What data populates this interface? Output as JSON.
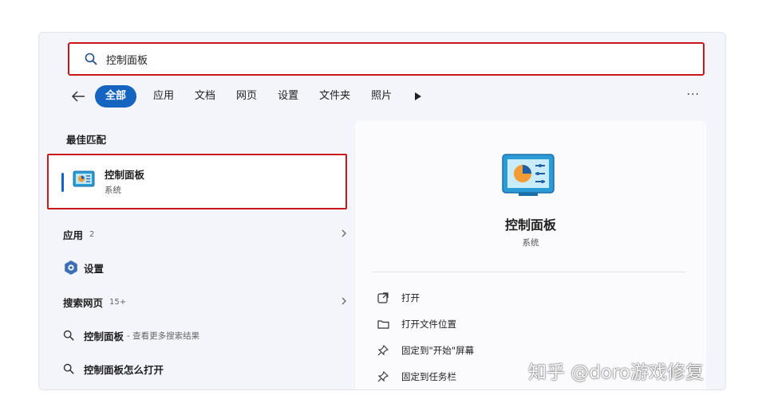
{
  "search": {
    "query": "控制面板",
    "icon": "search-icon"
  },
  "filters": {
    "tabs": [
      {
        "label": "全部",
        "active": true
      },
      {
        "label": "应用"
      },
      {
        "label": "文档"
      },
      {
        "label": "网页"
      },
      {
        "label": "设置"
      },
      {
        "label": "文件夹"
      },
      {
        "label": "照片"
      }
    ],
    "more_label": "···"
  },
  "left": {
    "best_match_title": "最佳匹配",
    "best_match": {
      "title": "控制面板",
      "subtitle": "系统"
    },
    "apps_section": {
      "label": "应用",
      "count": "2"
    },
    "settings_item": {
      "label": "设置"
    },
    "web_section": {
      "label": "搜索网页",
      "count": "15+"
    },
    "web_results": [
      {
        "label": "控制面板",
        "sub": "- 查看更多搜索结果"
      },
      {
        "label": "控制面板怎么打开",
        "sub": ""
      }
    ]
  },
  "right": {
    "title": "控制面板",
    "subtitle": "系统",
    "actions": [
      {
        "label": "打开",
        "icon": "open-icon"
      },
      {
        "label": "打开文件位置",
        "icon": "folder-icon"
      },
      {
        "label": "固定到\"开始\"屏幕",
        "icon": "pin-icon"
      },
      {
        "label": "固定到任务栏",
        "icon": "pin-icon"
      }
    ]
  },
  "watermark": "知乎 @doro游戏修复",
  "colors": {
    "accent": "#1565c0",
    "highlight_border": "#c8171f"
  }
}
